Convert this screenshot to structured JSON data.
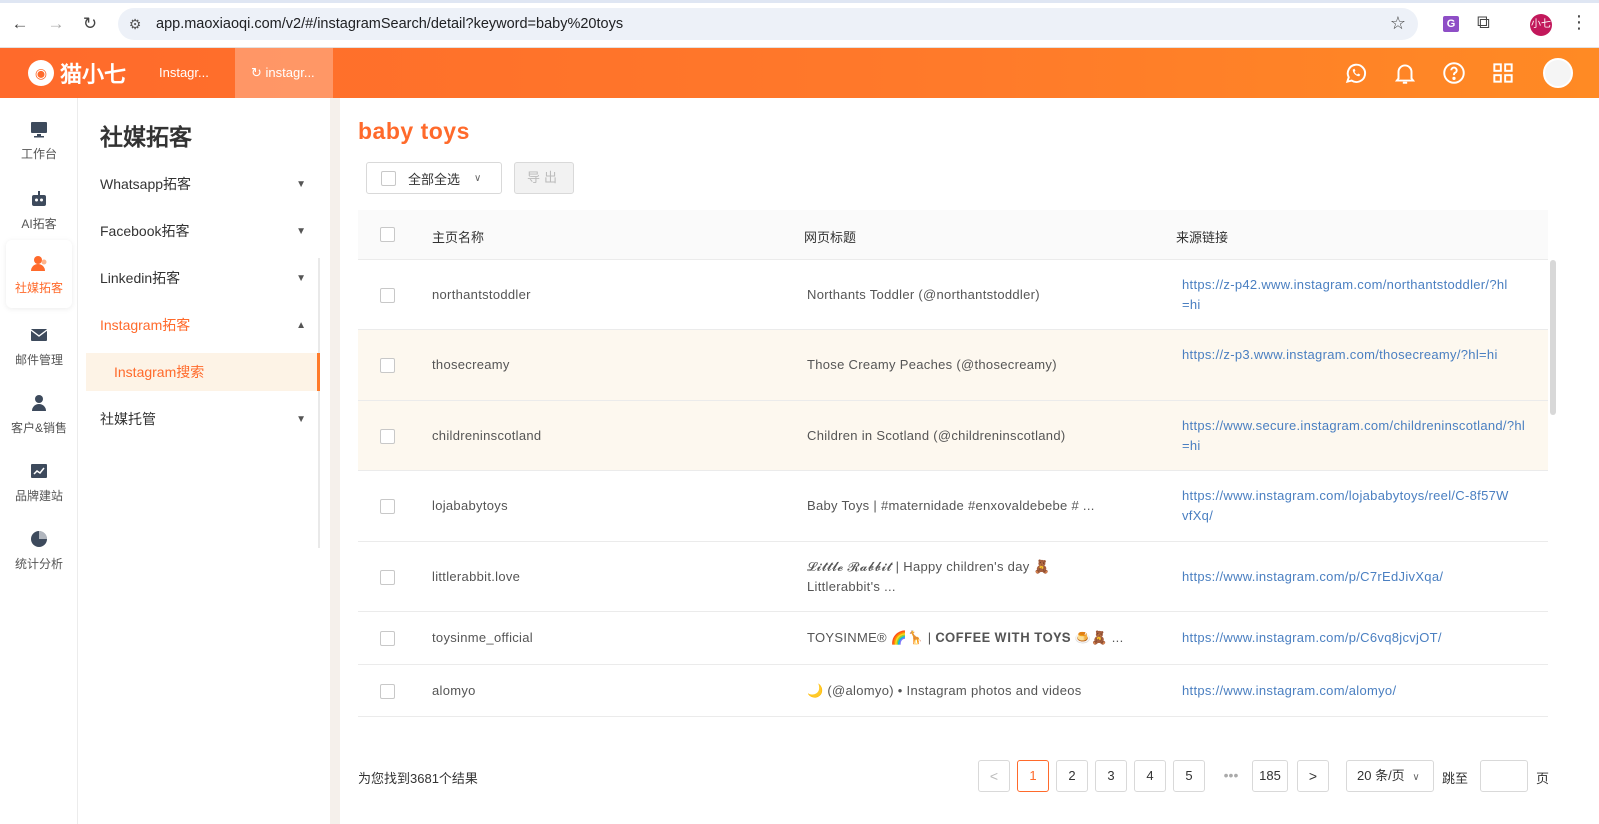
{
  "browser": {
    "url": "app.maoxiaoqi.com/v2/#/instagramSearch/detail?keyword=baby%20toys",
    "extension_letter": "G",
    "profile_label": "小七"
  },
  "header": {
    "logo_text": "猫小七",
    "tabs": [
      "Instagr...",
      "instagr..."
    ],
    "icons": [
      "whatsapp-icon",
      "bell-icon",
      "help-icon",
      "apps-grid-icon",
      "user-avatar"
    ]
  },
  "rail": {
    "items": [
      {
        "label": "工作台",
        "icon": "monitor-icon"
      },
      {
        "label": "AI拓客",
        "icon": "robot-icon"
      },
      {
        "label": "社媒拓客",
        "icon": "user-icon",
        "active": true
      },
      {
        "label": "邮件管理",
        "icon": "mail-icon"
      },
      {
        "label": "客户&销售",
        "icon": "person-badge-icon"
      },
      {
        "label": "品牌建站",
        "icon": "chart-icon"
      },
      {
        "label": "统计分析",
        "icon": "pie-icon"
      }
    ]
  },
  "sidebar": {
    "title": "社媒拓客",
    "menu": [
      {
        "label": "Whatsapp拓客",
        "expanded": false
      },
      {
        "label": "Facebook拓客",
        "expanded": false
      },
      {
        "label": "Linkedin拓客",
        "expanded": false
      },
      {
        "label": "Instagram拓客",
        "expanded": true
      },
      {
        "label": "社媒托管",
        "expanded": false
      }
    ],
    "submenu_active": "Instagram搜索"
  },
  "main": {
    "keyword": "baby toys",
    "select_all_label": "全部全选",
    "export_label": "导出",
    "columns": [
      "主页名称",
      "网页标题",
      "来源链接"
    ],
    "rows": [
      {
        "name": "northantstoddler",
        "title": "Northants Toddler (@northantstoddler)",
        "link": "https://z-p42.www.instagram.com/northantstoddler/?hl=hi"
      },
      {
        "name": "thosecreamy",
        "title": "Those Creamy Peaches (@thosecreamy)",
        "link": "https://z-p3.www.instagram.com/thosecreamy/?hl=hi"
      },
      {
        "name": "childreninscotland",
        "title": "Children in Scotland (@childreninscotland)",
        "link": "https://www.secure.instagram.com/childreninscotland/?hl=hi"
      },
      {
        "name": "lojababytoys",
        "title": "Baby Toys | #maternidade #enxovaldebebe # ...",
        "link": "https://www.instagram.com/lojababytoys/reel/C-8f57WvfXq/"
      },
      {
        "name": "littlerabbit.love",
        "title": "𝓛𝓲𝓽𝓽𝓵𝓮 𝓡𝓪𝓫𝓫𝓲𝓽 | Happy children's day 🧸 Littlerabbit's ...",
        "link": "https://www.instagram.com/p/C7rEdJivXqa/"
      },
      {
        "name": "toysinme_official",
        "title": "TOYSINME® 🌈🦒 | 𝐂𝐎𝐅𝐅𝐄𝐄 𝐖𝐈𝐓𝐇 𝐓𝐎𝐘𝐒 🍮🧸 ...",
        "link": "https://www.instagram.com/p/C6vq8jcvjOT/"
      },
      {
        "name": "alomyo",
        "title": "🌙 (@alomyo) • Instagram photos and videos",
        "link": "https://www.instagram.com/alomyo/"
      }
    ],
    "result_text": "为您找到3681个结果",
    "pages": [
      "1",
      "2",
      "3",
      "4",
      "5",
      "185"
    ],
    "current_page": "1",
    "ellipsis": "•••",
    "page_size": "20 条/页",
    "jump_label": "跳至",
    "jump_unit": "页"
  },
  "colors": {
    "accent": "#ff6a2b",
    "link": "#4a7fc1",
    "highlight_row": "#fdf8ef"
  }
}
